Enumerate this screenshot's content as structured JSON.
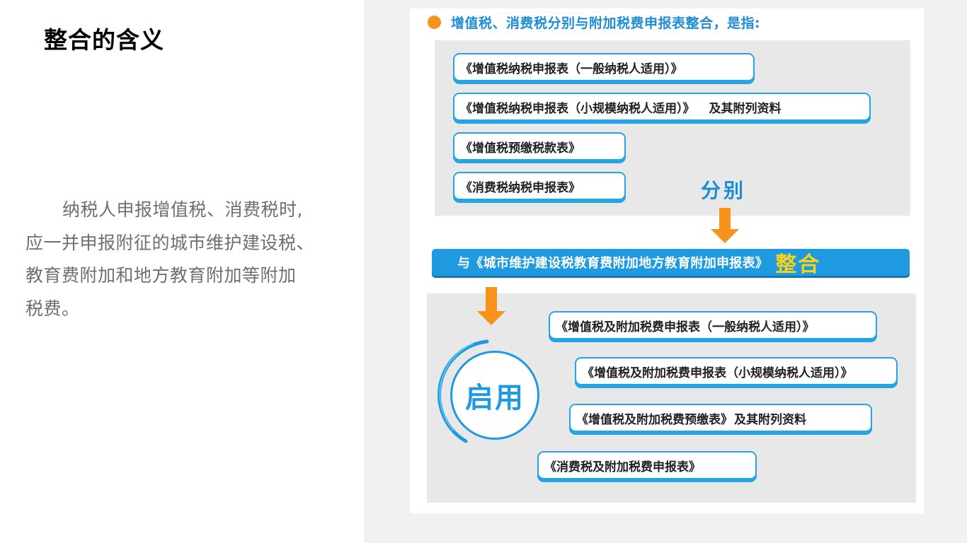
{
  "slide": {
    "title": "整合的含义",
    "body_lines": [
      "纳税人申报增值税、消费税时,",
      "应一并申报附征的城市维护建设税、",
      "教育费附加和地方教育附加等附加",
      "税费。"
    ]
  },
  "figure": {
    "heading": "增值税、消费税分别与附加税费申报表整合，是指:",
    "old_forms": [
      {
        "label": "《增值税纳税申报表（一般纳税人适用）》",
        "extra": ""
      },
      {
        "label": "《增值税纳税申报表（小规模纳税人适用）》",
        "extra": "及其附列资料"
      },
      {
        "label": "《增值税预缴税款表》",
        "extra": ""
      },
      {
        "label": "《消费税纳税申报表》",
        "extra": ""
      }
    ],
    "separately_label": "分别",
    "merge_bar": {
      "text": "与《城市维护建设税教育费附加地方教育附加申报表》",
      "highlight": "整合"
    },
    "enable_label": "启用",
    "new_forms": [
      {
        "label": "《增值税及附加税费申报表（一般纳税人适用）》",
        "extra": ""
      },
      {
        "label": "《增值税及附加税费申报表（小规模纳税人适用）》",
        "extra": ""
      },
      {
        "label": "《增值税及附加税费预缴表》",
        "extra": "及其附列资料"
      },
      {
        "label": "《消费税及附加税费申报表》",
        "extra": ""
      }
    ]
  },
  "colors": {
    "accent_blue": "#1f9ae0",
    "heading_blue": "#1e8dd4",
    "arrow_orange": "#f7931d",
    "highlight_yellow": "#f9d21a",
    "panel_gray": "#e8e8e8"
  }
}
